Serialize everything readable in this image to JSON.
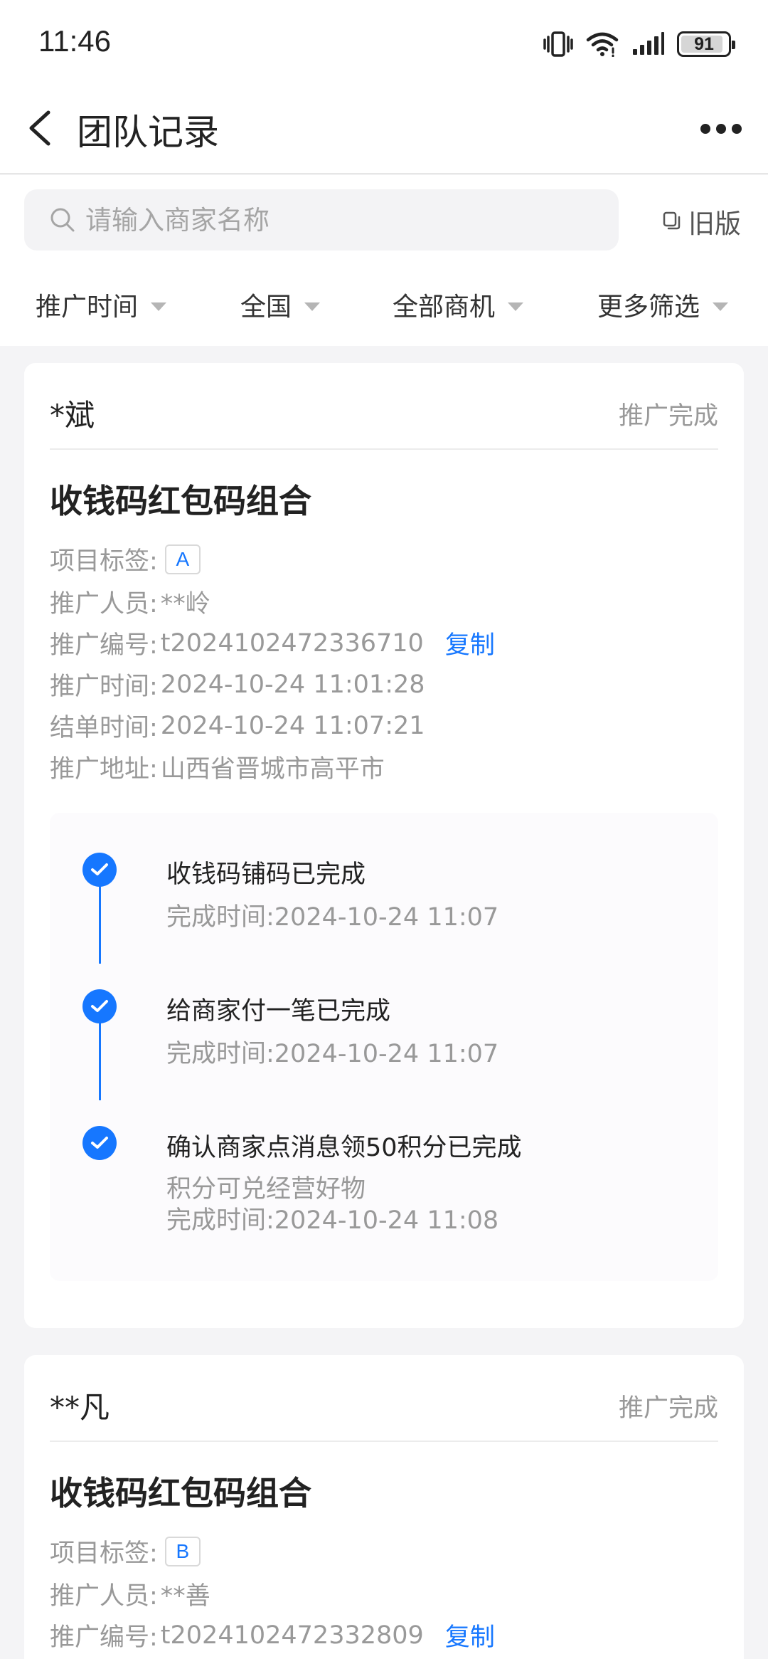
{
  "status_bar": {
    "time": "11:46",
    "battery": "91",
    "battery_level": 0.91
  },
  "nav": {
    "title": "团队记录"
  },
  "search": {
    "placeholder": "请输入商家名称",
    "old_version_label": "旧版"
  },
  "filters": [
    {
      "label": "推广时间"
    },
    {
      "label": "全国"
    },
    {
      "label": "全部商机"
    },
    {
      "label": "更多筛选"
    }
  ],
  "records": [
    {
      "merchant": "*斌",
      "status": "推广完成",
      "project": "收钱码红包码组合",
      "tag_label": "项目标签:",
      "tag": "A",
      "promoter_label": "推广人员:",
      "promoter": "**岭",
      "code_label": "推广编号:",
      "code": "t2024102472336710",
      "copy_label": "复制",
      "time_label": "推广时间:",
      "time": "2024-10-24 11:01:28",
      "settle_label": "结单时间:",
      "settle": "2024-10-24 11:07:21",
      "address_label": "推广地址:",
      "address": "山西省晋城市高平市",
      "steps": [
        {
          "title": "收钱码铺码已完成",
          "note": "",
          "done": "完成时间:2024-10-24 11:07"
        },
        {
          "title": "给商家付一笔已完成",
          "note": "",
          "done": "完成时间:2024-10-24 11:07"
        },
        {
          "title": "确认商家点消息领50积分已完成",
          "note": "积分可兑经营好物",
          "done": "完成时间:2024-10-24 11:08"
        }
      ]
    },
    {
      "merchant": "**凡",
      "status": "推广完成",
      "project": "收钱码红包码组合",
      "tag_label": "项目标签:",
      "tag": "B",
      "promoter_label": "推广人员:",
      "promoter": "**善",
      "code_label": "推广编号:",
      "code": "t2024102472332809",
      "copy_label": "复制"
    }
  ],
  "colors": {
    "accent": "#1677ff",
    "muted": "#999999",
    "background": "#f4f4f6"
  }
}
